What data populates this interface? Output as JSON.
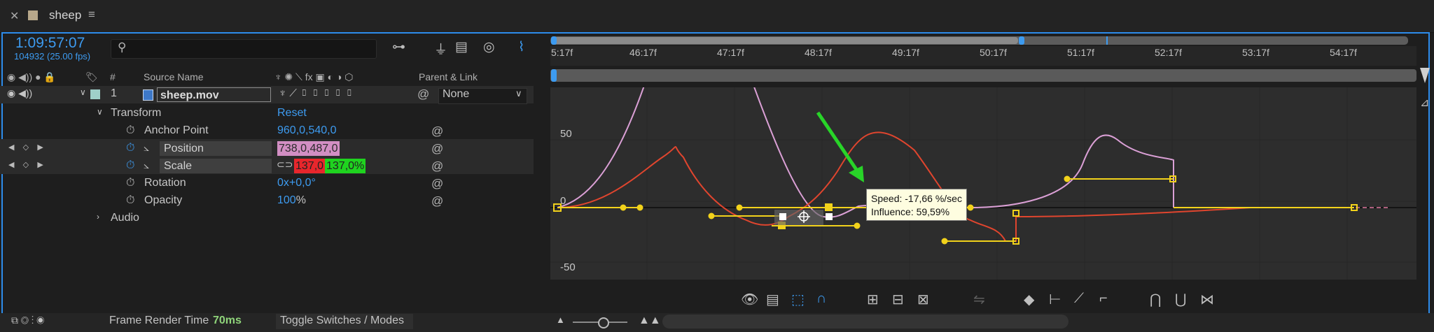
{
  "tab": {
    "title": "sheep"
  },
  "timecode": {
    "time": "1:09:57:07",
    "frames_fps": "104932 (25.00 fps)"
  },
  "columns": {
    "hash": "#",
    "source_name": "Source Name",
    "parent_link": "Parent & Link"
  },
  "layer": {
    "number": "1",
    "name": "sheep.mov",
    "parent": "None"
  },
  "transform": {
    "label": "Transform",
    "reset": "Reset",
    "anchor_label": "Anchor Point",
    "anchor_value": "960,0,540,0",
    "position_label": "Position",
    "position_value": "738,0,487,0",
    "scale_label": "Scale",
    "scale_x": "137,0",
    "scale_y": "137,0%",
    "rotation_label": "Rotation",
    "rotation_value": "0x+0,0°",
    "opacity_label": "Opacity",
    "opacity_value": "100",
    "opacity_unit": "%"
  },
  "audio": {
    "label": "Audio"
  },
  "ruler": {
    "ticks": [
      "5:17f",
      "46:17f",
      "47:17f",
      "48:17f",
      "49:17f",
      "50:17f",
      "51:17f",
      "52:17f",
      "53:17f",
      "54:17f"
    ]
  },
  "graph": {
    "y_labels": [
      "50",
      "0",
      "-50"
    ]
  },
  "tooltip": {
    "speed": "Speed: -17,66 %/sec",
    "influence": "Influence: 59,59%"
  },
  "footer": {
    "render_label": "Frame Render Time",
    "render_value": "70ms",
    "toggle": "Toggle Switches / Modes"
  },
  "colors": {
    "accent": "#3d9bf0",
    "position_highlight": "#d28ec3",
    "scale_x": "#e8262c",
    "scale_y": "#1fd31f",
    "curve_pink": "#dba0d6",
    "curve_red": "#e0452e",
    "handle_yellow": "#f2d21b",
    "arrow": "#28d428"
  }
}
